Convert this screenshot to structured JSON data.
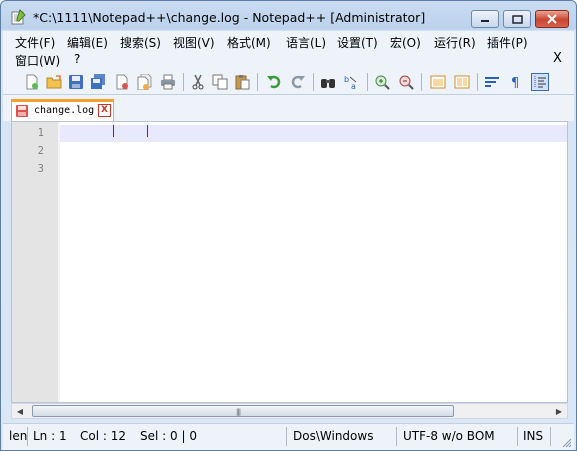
{
  "window": {
    "title": "*C:\\1111\\Notepad++\\change.log - Notepad++ [Administrator]"
  },
  "menu": {
    "items": [
      "文件(F)",
      "编辑(E)",
      "搜索(S)",
      "视图(V)",
      "格式(M)",
      "语言(L)",
      "设置(T)",
      "宏(O)",
      "运行(R)",
      "插件(P)",
      "窗口(W)",
      "?"
    ],
    "close_label": "X"
  },
  "toolbar": {
    "icons": [
      "new-file-icon",
      "open-file-icon",
      "save-icon",
      "save-all-icon",
      "close-icon",
      "close-all-icon",
      "print-icon",
      "cut-icon",
      "copy-icon",
      "paste-icon",
      "undo-icon",
      "redo-icon",
      "find-icon",
      "replace-icon",
      "zoom-in-icon",
      "zoom-out-icon",
      "sync-vertical-icon",
      "sync-horizontal-icon",
      "word-wrap-icon",
      "show-all-chars-icon",
      "indent-guide-icon"
    ]
  },
  "tabs": [
    {
      "label": "change.log",
      "close": "X"
    }
  ],
  "editor": {
    "line_numbers": [
      "1",
      "2",
      "3"
    ],
    "lines": [
      "",
      "",
      ""
    ]
  },
  "statusbar": {
    "length": "len",
    "line": "Ln : 1",
    "col": "Col : 12",
    "sel": "Sel : 0 | 0",
    "eol": "Dos\\Windows",
    "encoding": "UTF-8 w/o BOM",
    "mode": "INS"
  },
  "colors": {
    "tab_accent": "#f79f2f",
    "current_line": "#e8e8ff",
    "caret": "#8000ff",
    "close_button": "#c94632"
  }
}
